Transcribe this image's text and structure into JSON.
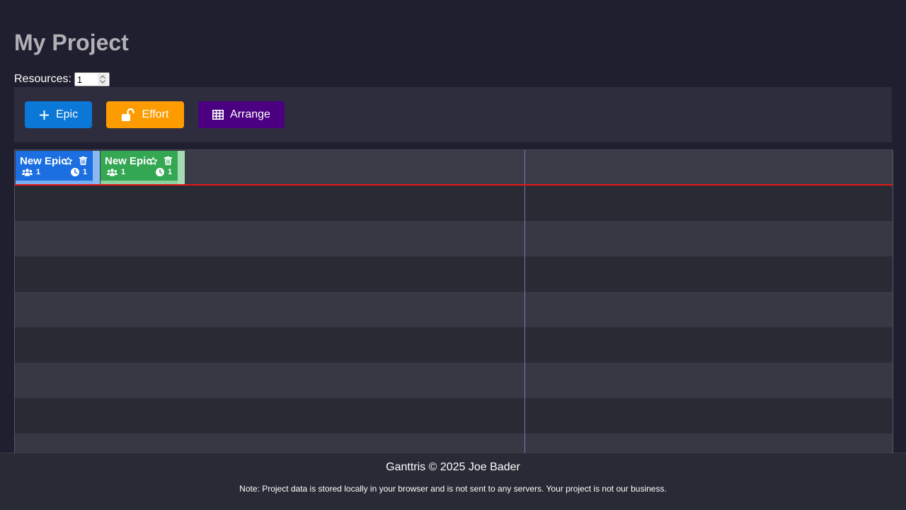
{
  "project": {
    "title": "My Project"
  },
  "resources": {
    "label": "Resources:",
    "value": "1"
  },
  "toolbar": {
    "epic_label": "Epic",
    "effort_label": "Effort",
    "arrange_label": "Arrange",
    "epic_icon": "plus-icon",
    "effort_icon": "unlock-icon",
    "arrange_icon": "grid-icon"
  },
  "colors": {
    "background": "#201f2f",
    "toolbar": "#2e2d3d",
    "epic_button": "#0b77d6",
    "effort_button": "#fd9c00",
    "arrange_button": "#4a0081",
    "lane_dark": "#282a34",
    "lane_light": "#363844",
    "header_lane": "#393b47",
    "today_line": "#e81616",
    "divider": "#7a78b5"
  },
  "epics": [
    {
      "title": "New Epic",
      "resources": "1",
      "effort": "1",
      "color": "#1b6fe0",
      "handle_color": "#8ab8f3",
      "bar_color": "#7aaef2"
    },
    {
      "title": "New Epic",
      "resources": "1",
      "effort": "1",
      "color": "#34a753",
      "handle_color": "#a8dbb5",
      "bar_color": "#8fd0a0"
    }
  ],
  "footer": {
    "copyright": "Ganttris © 2025 Joe Bader",
    "note": "Note: Project data is stored locally in your browser and is not sent to any servers. Your project is not our business."
  }
}
